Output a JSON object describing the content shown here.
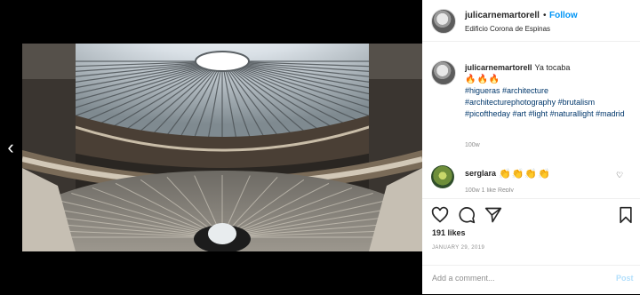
{
  "media": {
    "prev_arrow": "‹",
    "description_colors": {
      "sky": "#dfe6ec",
      "wood": "#6e5a43",
      "floor": "#9a948a"
    }
  },
  "header": {
    "username": "julicarnemartorell",
    "separator": "•",
    "follow_label": "Follow",
    "location": "Edificio Corona de Espinas"
  },
  "caption": {
    "username": "julicarnemartorell",
    "text": "Ya tocaba",
    "emoji": "🔥🔥🔥",
    "hashtags": "#higueras #architecture #architecturephotography #brutalism #picoftheday #art #light #naturallight #madrid",
    "time": "100w"
  },
  "comment": {
    "username": "serglara",
    "text": "👏👏👏👏",
    "heart_icon": "♡",
    "meta": "100w   1 like   Reply"
  },
  "likes": "191 likes",
  "date": "JANUARY 29, 2019",
  "add_comment": {
    "placeholder": "Add a comment...",
    "post_label": "Post"
  },
  "colors": {
    "link": "#0095f6",
    "hashtag": "#00376b",
    "muted": "#8e8e8e"
  }
}
